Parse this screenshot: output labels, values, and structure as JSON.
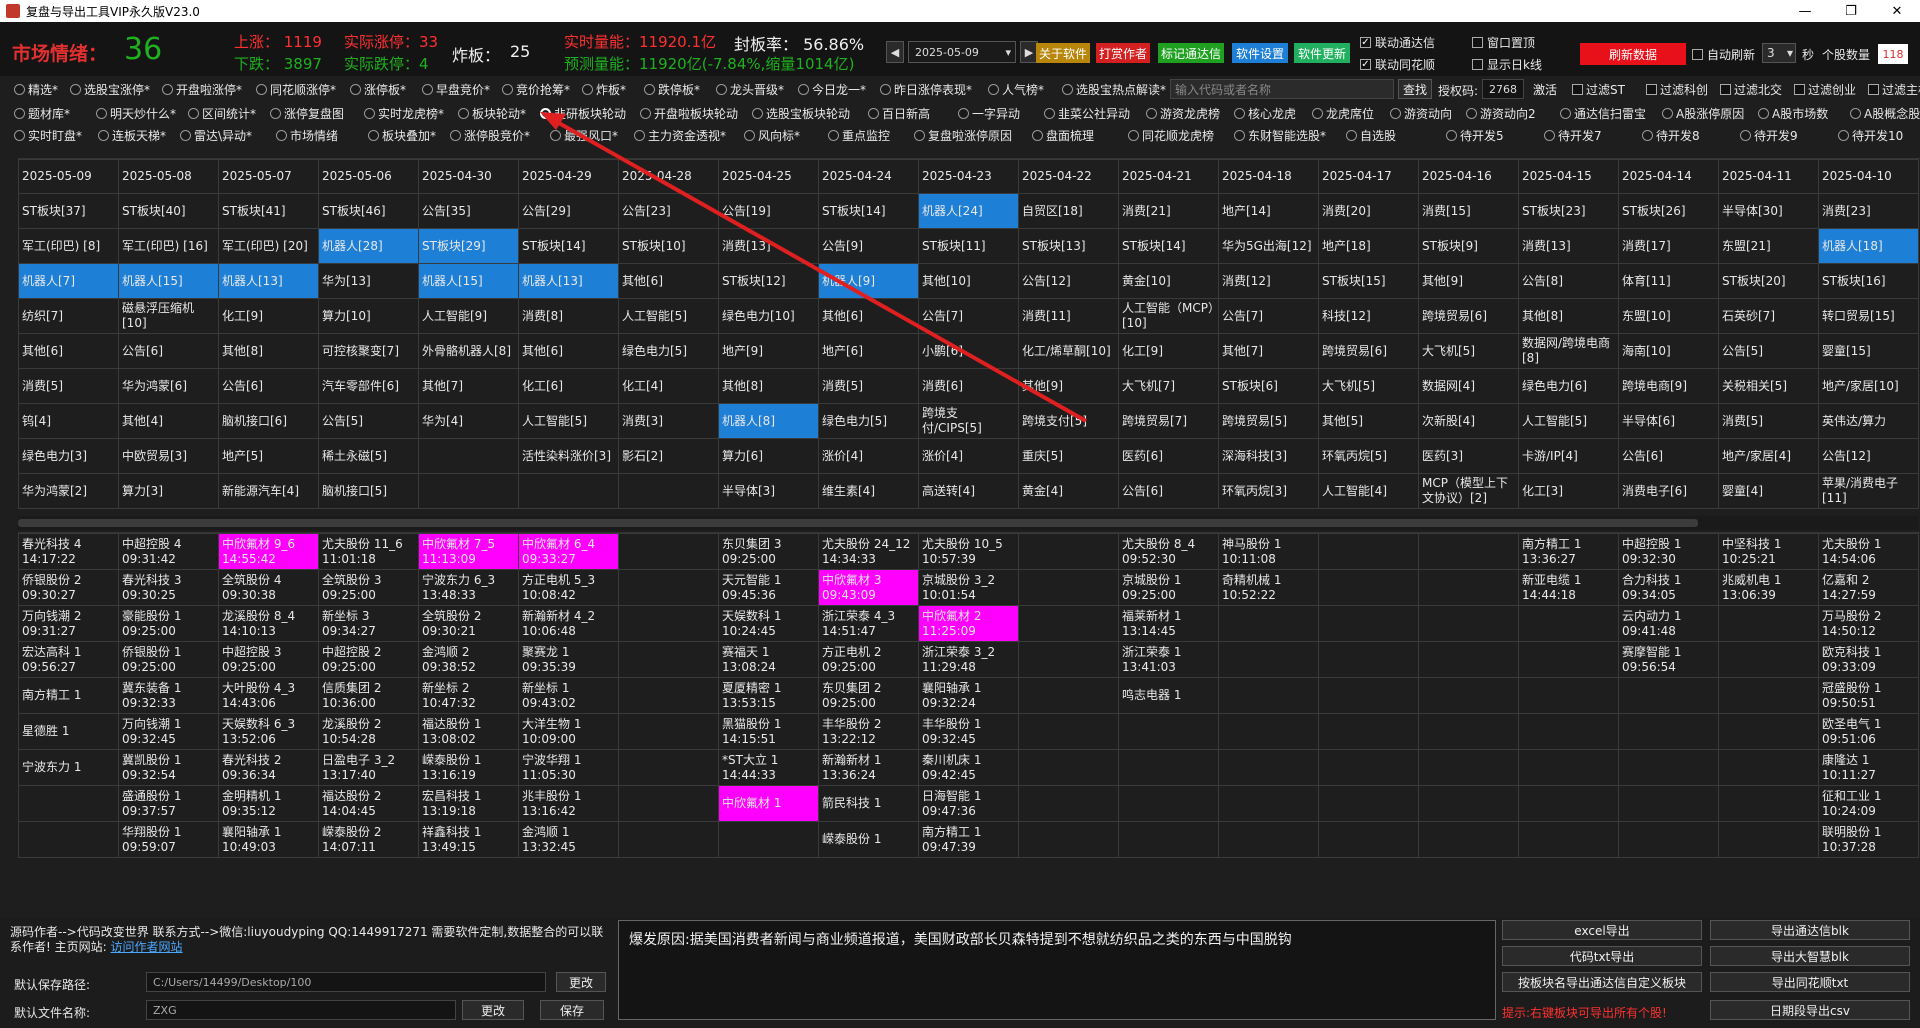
{
  "window": {
    "title": "复盘与导出工具VIP永久版V23.0",
    "min": "—",
    "max": "❐",
    "close": "✕"
  },
  "top": {
    "mood_label": "市场情绪：",
    "mood_value": "36",
    "rise": "上涨： 1119",
    "real_rise": "实际涨停：33",
    "fall": "下跌： 3897",
    "real_fall": "实际跌停：4",
    "board_break_label": "炸板：",
    "board_break_value": "25",
    "volume": "实时量能：11920.1亿",
    "seal_rate": "封板率：  56.86%",
    "forecast": "预测量能：11920亿(-7.84%,缩量1014亿)",
    "date": "2025-05-09",
    "btn_about": "关于软件",
    "btn_tip": "打赏作者",
    "btn_mark": "标记通达信",
    "btn_settings": "软件设置",
    "btn_update": "软件更新",
    "link_tdx": "联动通达信",
    "link_ths": "联动同花顺",
    "win_top": "窗口置顶",
    "show_day": "显示日k线",
    "refresh_btn": "刷新数据",
    "auto_refresh": "自动刷新",
    "refresh_sec": "3",
    "sec_unit": "秒",
    "stock_count_label": "个股数量",
    "stock_count": "118"
  },
  "row1": [
    "精选*",
    "选股宝涨停*",
    "开盘啦涨停*",
    "同花顺涨停*",
    "涨停板*",
    "早盘竞价*",
    "竞价抢筹*",
    "炸板*",
    "跌停板*",
    "龙头晋级*",
    "今日龙一*",
    "昨日涨停表现*",
    "人气榜*",
    "选股宝热点解读*"
  ],
  "row1_search": "输入代码或者名称",
  "row1_query": "查找",
  "row1_auth_label": "授权码:",
  "row1_auth": "2768",
  "row1_activate": "激活",
  "row1_filters": [
    "过滤ST",
    "过滤科创",
    "过滤北交",
    "过滤创业",
    "过滤主板"
  ],
  "row2": [
    "题材库*",
    "明天炒什么*",
    "区间统计*",
    "涨停复盘图",
    "实时龙虎榜*",
    "板块轮动*",
    "韭研板块轮动",
    "开盘啦板块轮动",
    "选股宝板块轮动",
    "百日新高",
    "一字异动",
    "韭菜公社异动",
    "游资龙虎榜",
    "核心龙虎",
    "龙虎席位",
    "游资动向",
    "游资动向2",
    "通达信扫雷宝",
    "A股涨停原因",
    "A股市场数",
    "A股概念股"
  ],
  "row3": [
    "实时盯盘*",
    "连板天梯*",
    "雷达\\异动*",
    "市场情绪",
    "板块叠加*",
    "涨停股竞价*",
    "最强风口*",
    "主力资金透视*",
    "风向标*",
    "重点监控",
    "复盘啦涨停原因",
    "盘面梳理",
    "同花顺龙虎榜",
    "东财智能选股*",
    "自选股",
    "待开发5",
    "待开发7",
    "待开发8",
    "待开发9",
    "待开发10"
  ],
  "grid1": {
    "headers": [
      "2025-05-09",
      "2025-05-08",
      "2025-05-07",
      "2025-05-06",
      "2025-04-30",
      "2025-04-29",
      "2025-04-28",
      "2025-04-25",
      "2025-04-24",
      "2025-04-23",
      "2025-04-22",
      "2025-04-21",
      "2025-04-18",
      "2025-04-17",
      "2025-04-16",
      "2025-04-15",
      "2025-04-14",
      "2025-04-11",
      "2025-04-10"
    ],
    "rows": [
      [
        "ST板块[37]",
        "ST板块[40]",
        "ST板块[41]",
        "ST板块[46]",
        "公告[35]",
        "公告[29]",
        "公告[23]",
        "公告[19]",
        "ST板块[14]",
        "机器人[24]",
        "自贸区[18]",
        "消费[21]",
        "地产[14]",
        "消费[20]",
        "消费[15]",
        "ST板块[23]",
        "ST板块[26]",
        "半导体[30]",
        "消费[23]"
      ],
      [
        "军工(印巴) [8]",
        "军工(印巴) [16]",
        "军工(印巴) [20]",
        "机器人[28]",
        "ST板块[29]",
        "ST板块[14]",
        "ST板块[10]",
        "消费[13]",
        "公告[9]",
        "ST板块[11]",
        "ST板块[13]",
        "ST板块[14]",
        "华为5G出海[12]",
        "地产[18]",
        "ST板块[9]",
        "消费[13]",
        "消费[17]",
        "东盟[21]",
        "机器人[18]"
      ],
      [
        "机器人[7]",
        "机器人[15]",
        "机器人[13]",
        "华为[13]",
        "机器人[15]",
        "机器人[13]",
        "其他[6]",
        "ST板块[12]",
        "机器人[9]",
        "其他[10]",
        "公告[12]",
        "黄金[10]",
        "消费[12]",
        "ST板块[15]",
        "其他[9]",
        "公告[8]",
        "体育[11]",
        "ST板块[20]",
        "ST板块[16]"
      ],
      [
        "纺织[7]",
        "磁悬浮压缩机[10]",
        "化工[9]",
        "算力[10]",
        "人工智能[9]",
        "消费[8]",
        "人工智能[5]",
        "绿色电力[10]",
        "其他[6]",
        "公告[7]",
        "消费[11]",
        "人工智能（MCP）[10]",
        "公告[7]",
        "科技[12]",
        "跨境贸易[6]",
        "其他[8]",
        "东盟[10]",
        "石英砂[7]",
        "转口贸易[15]"
      ],
      [
        "其他[6]",
        "公告[6]",
        "其他[8]",
        "可控核聚变[7]",
        "外骨骼机器人[8]",
        "其他[6]",
        "绿色电力[5]",
        "地产[9]",
        "地产[6]",
        "小鹏[6]",
        "化工/烯草酮[10]",
        "化工[9]",
        "其他[7]",
        "跨境贸易[6]",
        "大飞机[5]",
        "数据网/跨境电商[8]",
        "海南[10]",
        "公告[5]",
        "婴童[15]"
      ],
      [
        "消费[5]",
        "华为鸿蒙[6]",
        "公告[6]",
        "汽车零部件[6]",
        "其他[7]",
        "化工[6]",
        "化工[4]",
        "其他[8]",
        "消费[5]",
        "消费[6]",
        "其他[9]",
        "大飞机[7]",
        "ST板块[6]",
        "大飞机[5]",
        "数据网[4]",
        "绿色电力[6]",
        "跨境电商[9]",
        "关税相关[5]",
        "地产/家居[10]"
      ],
      [
        "钨[4]",
        "其他[4]",
        "脑机接口[6]",
        "公告[5]",
        "华为[4]",
        "人工智能[5]",
        "消费[3]",
        "机器人[8]",
        "绿色电力[5]",
        "跨境支付/CIPS[5]",
        "跨境支付[5]",
        "跨境贸易[7]",
        "跨境贸易[5]",
        "其他[5]",
        "次新股[4]",
        "人工智能[5]",
        "半导体[6]",
        "消费[5]",
        "英伟达/算力"
      ],
      [
        "绿色电力[3]",
        "中欧贸易[3]",
        "地产[5]",
        "稀土永磁[5]",
        "",
        "活性染料涨价[3]",
        "影石[2]",
        "算力[6]",
        "涨价[4]",
        "涨价[4]",
        "重庆[5]",
        "医药[6]",
        "深海科技[3]",
        "环氧丙烷[5]",
        "医药[3]",
        "卡游/IP[4]",
        "公告[6]",
        "地产/家居[4]",
        "公告[12]"
      ],
      [
        "华为鸿蒙[2]",
        "算力[3]",
        "新能源汽车[4]",
        "脑机接口[5]",
        "",
        "",
        "",
        "半导体[3]",
        "维生素[4]",
        "高送转[4]",
        "黄金[4]",
        "公告[6]",
        "环氧丙烷[3]",
        "人工智能[4]",
        "MCP（模型上下文协议）[2]",
        "化工[3]",
        "消费电子[6]",
        "婴童[4]",
        "苹果/消费电子[11]"
      ]
    ],
    "blue_cells": [
      [
        2,
        0
      ],
      [
        2,
        1
      ],
      [
        2,
        2
      ],
      [
        1,
        3
      ],
      [
        1,
        4
      ],
      [
        2,
        4
      ],
      [
        2,
        5
      ],
      [
        2,
        8
      ],
      [
        0,
        9
      ],
      [
        6,
        7
      ],
      [
        1,
        18
      ]
    ]
  },
  "grid2": {
    "rows": [
      [
        "春光科技  4\n14:17:22",
        "中超控股  4\n09:31:42",
        "中欣氟材  9_6\n14:55:42",
        "尤夫股份  11_6\n11:01:18",
        "中欣氟材  7_5\n11:13:09",
        "中欣氟材  6_4\n09:33:27",
        "",
        "东贝集团  3\n09:25:00",
        "尤夫股份  24_12\n14:34:33",
        "尤夫股份  10_5\n10:57:39",
        "",
        "尤夫股份  8_4\n09:52:30",
        "神马股份  1\n10:11:08",
        "",
        "",
        "南方精工  1\n13:36:27",
        "中超控股  1\n09:32:30",
        "中坚科技  1\n10:25:21",
        "尤夫股份  1\n14:54:06"
      ],
      [
        "侨银股份  2\n09:30:27",
        "春光科技  3\n09:30:25",
        "全筑股份  4\n09:30:38",
        "全筑股份  3\n09:25:00",
        "宁波东力  6_3\n13:48:33",
        "方正电机  5_3\n10:08:42",
        "",
        "天元智能  1\n09:45:36",
        "中欣氟材  3\n09:43:09",
        "京城股份  3_2\n10:01:54",
        "",
        "京城股份  1\n09:25:00",
        "奇精机械  1\n10:52:22",
        "",
        "",
        "新亚电缆  1\n14:44:18",
        "合力科技  1\n09:34:05",
        "兆威机电  1\n13:06:39",
        "亿嘉和  2\n14:27:59"
      ],
      [
        "万向钱潮  2\n09:31:27",
        "豪能股份  1\n09:25:00",
        "龙溪股份  8_4\n14:10:13",
        "新坐标  3\n09:34:27",
        "全筑股份  2\n09:30:21",
        "新瀚新材  4_2\n10:06:48",
        "",
        "天娱数科  1\n10:24:45",
        "浙江荣泰  4_3\n14:51:47",
        "中欣氟材  2\n11:25:09",
        "",
        "福莱新材  1\n13:14:45",
        "",
        "",
        "",
        "",
        "云内动力  1\n09:41:48",
        "",
        "万马股份  2\n14:50:12"
      ],
      [
        "宏达高科  1\n09:56:27",
        "侨银股份  1\n09:25:00",
        "中超控股  3\n09:25:00",
        "中超控股  2\n09:25:00",
        "金鸿顺  2\n09:38:52",
        "聚赛龙  1\n09:35:39",
        "",
        "赛福天  1\n13:08:24",
        "方正电机  2\n09:25:00",
        "浙江荣泰  3_2\n11:29:48",
        "",
        "浙江荣泰  1\n13:41:03",
        "",
        "",
        "",
        "",
        "赛摩智能  1\n09:56:54",
        "",
        "欧克科技  1\n09:33:09"
      ],
      [
        "南方精工  1\n",
        "冀东装备  1\n09:32:33",
        "大叶股份  4_3\n14:43:06",
        "信质集团  2\n10:36:00",
        "新坐标  2\n10:47:32",
        "新坐标  1\n09:43:02",
        "",
        "夏厦精密  1\n13:53:15",
        "东贝集团  2\n09:25:00",
        "襄阳轴承  1\n09:32:24",
        "",
        "鸣志电器  1\n",
        "",
        "",
        "",
        "",
        "",
        "",
        "冠盛股份  1\n09:50:51"
      ],
      [
        "星德胜  1\n",
        "万向钱潮  1\n09:32:45",
        "天娱数科  6_3\n13:52:06",
        "龙溪股份  2\n10:54:28",
        "福达股份  1\n13:08:02",
        "大洋生物  1\n10:09:00",
        "",
        "黑猫股份  1\n14:15:51",
        "丰华股份  2\n13:22:12",
        "丰华股份  1\n09:32:45",
        "",
        "",
        "",
        "",
        "",
        "",
        "",
        "",
        "欧圣电气  1\n09:51:06"
      ],
      [
        "宁波东力  1\n",
        "冀凯股份  1\n09:32:54",
        "春光科技  2\n09:36:34",
        "日盈电子  3_2\n13:17:40",
        "嵘泰股份  1\n13:16:19",
        "宁波华翔  1\n11:05:30",
        "",
        "*ST大立  1\n14:44:33",
        "新瀚新材  1\n13:36:24",
        "秦川机床  1\n09:42:45",
        "",
        "",
        "",
        "",
        "",
        "",
        "",
        "",
        "康隆达  1\n10:11:27"
      ],
      [
        "",
        "盛通股份  1\n09:37:57",
        "金明精机  1\n09:35:12",
        "福达股份  2\n14:04:45",
        "宏昌科技  1\n13:19:18",
        "兆丰股份  1\n13:16:42",
        "",
        "中欣氟材  1\n",
        "箭民科技  1\n",
        "日海智能  1\n09:47:36",
        "",
        "",
        "",
        "",
        "",
        "",
        "",
        "",
        "征和工业  1\n10:24:09"
      ],
      [
        "",
        "华翔股份  1\n09:59:07",
        "襄阳轴承  1\n10:49:03",
        "嵘泰股份  2\n14:07:11",
        "祥鑫科技  1\n13:49:15",
        "金鸿顺  1\n13:32:45",
        "",
        "",
        "嵘泰股份  1\n",
        "南方精工  1\n09:47:39",
        "",
        "",
        "",
        "",
        "",
        "",
        "",
        "",
        "联明股份  1\n10:37:28"
      ]
    ],
    "magenta_cells": [
      [
        0,
        2
      ],
      [
        0,
        4
      ],
      [
        0,
        5
      ],
      [
        1,
        8
      ],
      [
        2,
        9
      ],
      [
        7,
        7
      ]
    ]
  },
  "bottom": {
    "src_text": "源码作者-->代码改变世界 联系方式-->微信:liuyoudyping QQ:1449917271 需要软件定制,数据整合的可以联系作者! 主页网站:",
    "src_link": "访问作者网站",
    "path_label": "默认保存路径:",
    "path_value": "C:/Users/14499/Desktop/100",
    "path_btn": "更改",
    "file_label": "默认文件名称:",
    "file_value": "ZXG",
    "file_btn": "更改",
    "save_btn": "保存",
    "reason": "爆发原因:据美国消费者新闻与商业频道报道，美国财政部长贝森特提到不想就纺织品之类的东西与中国脱钩",
    "btn_excel": "excel导出",
    "btn_tdx": "导出通达信blk",
    "btn_txt": "代码txt导出",
    "btn_dzh": "导出大智慧blk",
    "btn_custom": "按板块名导出通达信自定义板块",
    "btn_ths": "导出同花顺txt",
    "btn_csv": "日期段导出csv",
    "tip": "提示:右键板块可导出所有个股!"
  },
  "colors": {
    "accent_red": "#ff3030",
    "accent_green": "#1eb01e",
    "blue_cell": "#1e7fd6",
    "magenta_cell": "#ff00ff"
  }
}
